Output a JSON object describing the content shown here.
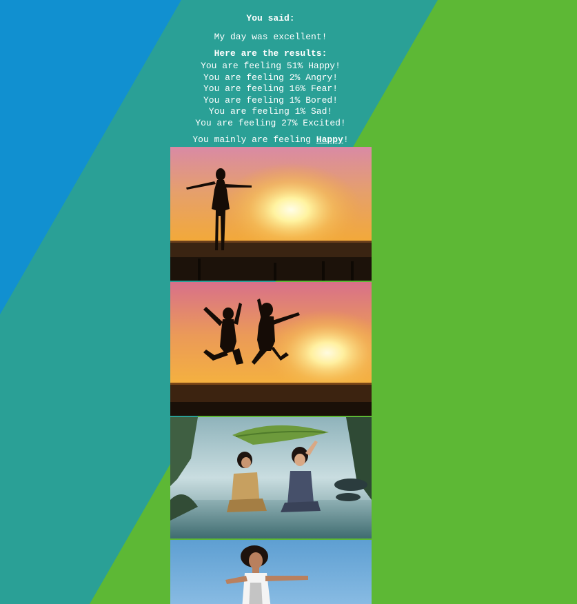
{
  "said": {
    "heading": "You said:",
    "text": "My day was excellent!"
  },
  "results": {
    "heading": "Here are the results:",
    "items": [
      "You are feeling 51% Happy!",
      "You are feeling 2% Angry!",
      "You are feeling 16% Fear!",
      "You are feeling 1% Bored!",
      "You are feeling 1% Sad!",
      "You are feeling 27% Excited!"
    ]
  },
  "summary": {
    "prefix": "You mainly are feeling ",
    "emotion": "Happy",
    "suffix": "!"
  },
  "colors": {
    "blue": "#1190d0",
    "teal": "#2aa096",
    "green": "#5db835"
  },
  "images": [
    {
      "name": "woman-arms-outstretched-sunset-photo"
    },
    {
      "name": "two-girls-jumping-sunset-photo"
    },
    {
      "name": "girls-laughing-under-leaf-rain-photo"
    },
    {
      "name": "woman-jumping-blue-sky-photo"
    }
  ]
}
